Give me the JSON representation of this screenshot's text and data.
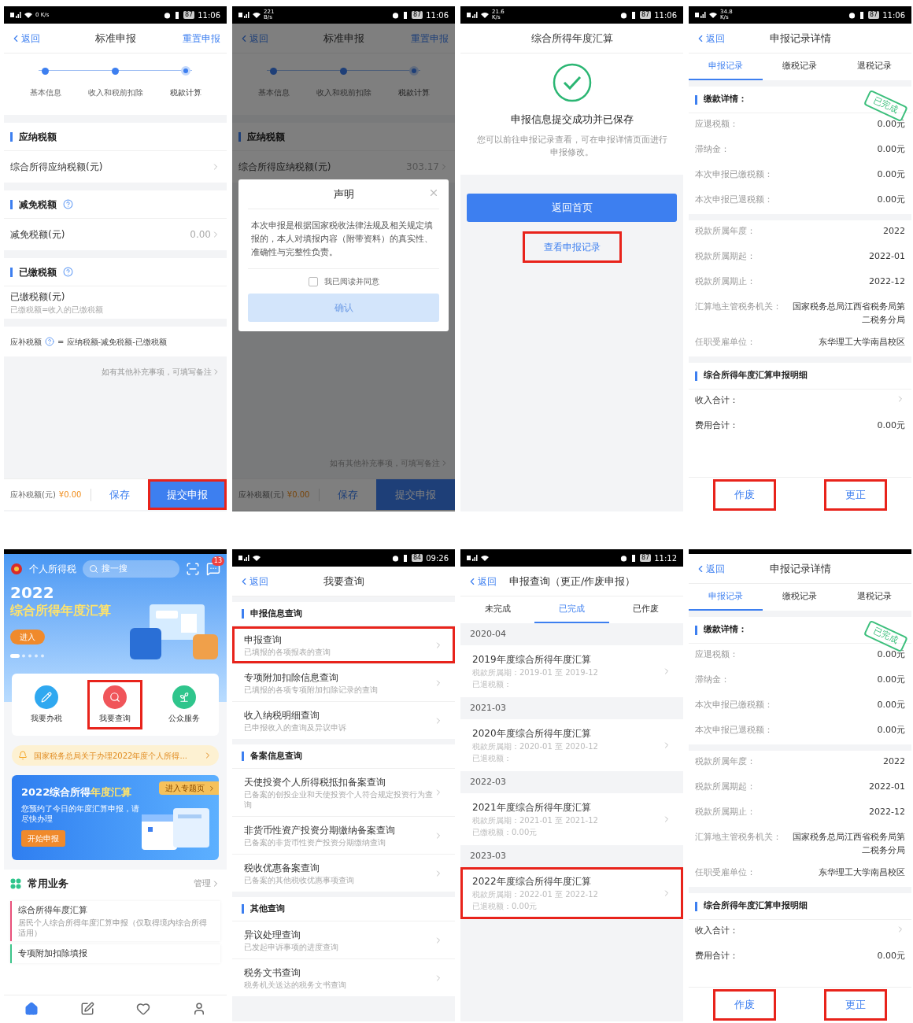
{
  "phones": [
    {
      "kind": "standard_report",
      "status": {
        "speed": "0 K/s",
        "battery": "87",
        "time": "11:06"
      },
      "nav": {
        "back": "返回",
        "title": "标准申报",
        "action": "重置申报"
      },
      "steps": [
        {
          "label": "基本信息",
          "selected": false
        },
        {
          "label": "收入和税前扣除",
          "selected": false
        },
        {
          "label": "税款计算",
          "selected": true
        }
      ],
      "sections": [
        {
          "title": "应纳税额",
          "help": false,
          "row": {
            "label": "综合所得应纳税额(元)",
            "arrow": true
          }
        },
        {
          "title": "减免税额",
          "help": true,
          "row": {
            "label": "减免税额(元)",
            "value": "0.00",
            "arrow": true
          }
        },
        {
          "title": "已缴税额",
          "help": true,
          "row": {
            "label": "已缴税额(元)",
            "note": "已缴税额=收入的已缴税额",
            "arrow": false
          }
        }
      ],
      "formula": {
        "label": "应补税额",
        "text": "= 应纳税额-减免税额-已缴税额"
      },
      "remark": "如有其他补充事项，可填写备注",
      "footer": {
        "label": "应补税额(元)",
        "amount": "¥0.00",
        "save": "保存",
        "submit": "提交申报",
        "highlighted": true
      }
    },
    {
      "kind": "standard_report",
      "status": {
        "speed": "221 B/s",
        "battery": "87",
        "time": "11:06"
      },
      "nav": {
        "back": "返回",
        "title": "标准申报",
        "action": "重置申报"
      },
      "steps": [
        {
          "label": "基本信息",
          "selected": false
        },
        {
          "label": "收入和税前扣除",
          "selected": false
        },
        {
          "label": "税款计算",
          "selected": true
        }
      ],
      "sections": [
        {
          "title": "应纳税额",
          "help": false,
          "row": {
            "label": "综合所得应纳税额(元)",
            "value": "303.17",
            "arrow": true
          }
        }
      ],
      "remark": "如有其他补充事项，可填写备注",
      "footer": {
        "label": "应补税额(元)",
        "amount": "¥0.00",
        "save": "保存",
        "submit": "提交申报",
        "highlighted": false
      },
      "dialog": {
        "title": "声明",
        "body": "本次申报是根据国家税收法律法规及相关规定填报的，本人对填报内容（附带资料）的真实性、准确性与完整性负责。",
        "agree": {
          "label": "我已阅读并同意",
          "checked": false
        },
        "confirm": {
          "label": "确认",
          "disabled": true
        }
      }
    },
    {
      "kind": "submit_success",
      "status": {
        "speed": "21.6 K/s",
        "battery": "87",
        "time": "11:06"
      },
      "nav": {
        "title": "综合所得年度汇算"
      },
      "heading": "申报信息提交成功并已保存",
      "message": "您可以前往申报记录查看，可在申报详情页面进行申报修改。",
      "primary": "返回首页",
      "link": {
        "label": "查看申报记录",
        "highlighted": true
      }
    },
    {
      "kind": "record_detail",
      "status": {
        "speed": "34.8 K/s",
        "battery": "87",
        "time": "11:06"
      },
      "nav": {
        "back": "返回",
        "title": "申报记录详情"
      },
      "tabs": [
        {
          "label": "申报记录",
          "selected": true
        },
        {
          "label": "缴税记录",
          "selected": false
        },
        {
          "label": "退税记录",
          "selected": false
        }
      ],
      "payment": {
        "title": "缴款详情：",
        "stamp": "已完成",
        "rows": [
          {
            "label": "应退税额：",
            "value": "0.00元"
          },
          {
            "label": "滞纳金：",
            "value": "0.00元"
          },
          {
            "label": "本次申报已缴税额：",
            "value": "0.00元"
          },
          {
            "label": "本次申报已退税额：",
            "value": "0.00元"
          }
        ]
      },
      "info_rows": [
        {
          "label": "税款所属年度：",
          "value": "2022"
        },
        {
          "label": "税款所属期起：",
          "value": "2022-01"
        },
        {
          "label": "税款所属期止：",
          "value": "2022-12"
        },
        {
          "label": "汇算地主管税务机关：",
          "value": "国家税务总局江西省税务局第二税务分局"
        },
        {
          "label": "任职受雇单位：",
          "value": "东华理工大学南昌校区"
        }
      ],
      "detail": {
        "title": "综合所得年度汇算申报明细",
        "rows": [
          {
            "label": "收入合计：",
            "arrow": true
          },
          {
            "label": "费用合计：",
            "value": "0.00元",
            "arrow": false
          }
        ]
      },
      "actions": [
        {
          "label": "作废",
          "highlighted": true
        },
        {
          "label": "更正",
          "highlighted": true
        }
      ]
    },
    {
      "kind": "home",
      "brand": "个人所得税",
      "search": {
        "placeholder": "搜一搜"
      },
      "badge": "13",
      "banner": {
        "year": "2022",
        "title": "综合所得年度汇算",
        "button": "进入"
      },
      "services": [
        {
          "kind": "pencil",
          "label": "我要办税",
          "color": "#2fa8f0",
          "highlighted": false
        },
        {
          "kind": "search",
          "label": "我要查询",
          "color": "#f0555a",
          "highlighted": true
        },
        {
          "kind": "sprout",
          "label": "公众服务",
          "color": "#2fc58c",
          "highlighted": false
        }
      ],
      "notice": "国家税务总局关于办理2022年度个人所得...",
      "promo": {
        "title": "2022综合所得",
        "accent": "年度汇算",
        "tag": "进入专题页",
        "text": "您预约了今日的年度汇算申报，请尽快办理",
        "button": "开始申报"
      },
      "common": {
        "title": "常用业务",
        "manage": "管理",
        "items": [
          {
            "title": "综合所得年度汇算",
            "desc": "居民个人综合所得年度汇算申报（仅取得境内综合所得适用）",
            "color": "#e8507a"
          },
          {
            "title": "专项附加扣除填报",
            "color": "#3cc48a"
          }
        ]
      },
      "tabbar": [
        {
          "kind": "home",
          "selected": true
        },
        {
          "kind": "list",
          "selected": false
        },
        {
          "kind": "heart",
          "selected": false
        },
        {
          "kind": "user",
          "selected": false
        }
      ]
    },
    {
      "kind": "query_menu",
      "status": {
        "battery": "84",
        "time": "09:26"
      },
      "nav": {
        "back": "返回",
        "title": "我要查询"
      },
      "groups": [
        {
          "title": "申报信息查询",
          "items": [
            {
              "title": "申报查询",
              "desc": "已填报的各项报表的查询",
              "highlighted": true
            },
            {
              "title": "专项附加扣除信息查询",
              "desc": "已填报的各项专项附加扣除记录的查询",
              "highlighted": false
            },
            {
              "title": "收入纳税明细查询",
              "desc": "已申报收入的查询及异议申诉",
              "highlighted": false
            }
          ]
        },
        {
          "title": "备案信息查询",
          "items": [
            {
              "title": "天使投资个人所得税抵扣备案查询",
              "desc": "已备案的创投企业和天使投资个人符合规定投资行为查询",
              "highlighted": false
            },
            {
              "title": "非货币性资产投资分期缴纳备案查询",
              "desc": "已备案的非货币性资产投资分期缴纳查询",
              "highlighted": false
            },
            {
              "title": "税收优惠备案查询",
              "desc": "已备案的其他税收优惠事项查询",
              "highlighted": false
            }
          ]
        },
        {
          "title": "其他查询",
          "items": [
            {
              "title": "异议处理查询",
              "desc": "已发起申诉事项的进度查询",
              "highlighted": false
            },
            {
              "title": "税务文书查询",
              "desc": "税务机关送达的税务文书查询",
              "highlighted": false
            }
          ]
        }
      ]
    },
    {
      "kind": "record_list",
      "status": {
        "battery": "87",
        "time": "11:12"
      },
      "nav": {
        "back": "返回",
        "title": "申报查询（更正/作废申报）"
      },
      "tabs": [
        {
          "label": "未完成",
          "selected": false
        },
        {
          "label": "已完成",
          "selected": true
        },
        {
          "label": "已作废",
          "selected": false
        }
      ],
      "records": [
        {
          "date": "2020-04",
          "title": "2019年度综合所得年度汇算",
          "period": "税款所属期：2019-01 至 2019-12",
          "amount": "已退税额：",
          "highlighted": false
        },
        {
          "date": "2021-03",
          "title": "2020年度综合所得年度汇算",
          "period": "税款所属期：2020-01 至 2020-12",
          "amount": "已退税额：",
          "highlighted": false
        },
        {
          "date": "2022-03",
          "title": "2021年度综合所得年度汇算",
          "period": "税款所属期：2021-01 至 2021-12",
          "amount": "已缴税额：0.00元",
          "highlighted": false
        },
        {
          "date": "2023-03",
          "title": "2022年度综合所得年度汇算",
          "period": "税款所属期：2022-01 至 2022-12",
          "amount": "已退税额：0.00元",
          "highlighted": true
        }
      ]
    },
    {
      "kind": "record_detail",
      "nav": {
        "back": "返回",
        "title": "申报记录详情"
      },
      "tabs": [
        {
          "label": "申报记录",
          "selected": true
        },
        {
          "label": "缴税记录",
          "selected": false
        },
        {
          "label": "退税记录",
          "selected": false
        }
      ],
      "payment": {
        "title": "缴款详情：",
        "stamp": "已完成",
        "rows": [
          {
            "label": "应退税额：",
            "value": "0.00元"
          },
          {
            "label": "滞纳金：",
            "value": "0.00元"
          },
          {
            "label": "本次申报已缴税额：",
            "value": "0.00元"
          },
          {
            "label": "本次申报已退税额：",
            "value": "0.00元"
          }
        ]
      },
      "info_rows": [
        {
          "label": "税款所属年度：",
          "value": "2022"
        },
        {
          "label": "税款所属期起：",
          "value": "2022-01"
        },
        {
          "label": "税款所属期止：",
          "value": "2022-12"
        },
        {
          "label": "汇算地主管税务机关：",
          "value": "国家税务总局江西省税务局第二税务分局"
        },
        {
          "label": "任职受雇单位：",
          "value": "东华理工大学南昌校区"
        }
      ],
      "detail": {
        "title": "综合所得年度汇算申报明细",
        "rows": [
          {
            "label": "收入合计：",
            "arrow": true
          },
          {
            "label": "费用合计：",
            "value": "0.00元",
            "arrow": false
          }
        ]
      },
      "actions": [
        {
          "label": "作废",
          "highlighted": true
        },
        {
          "label": "更正",
          "highlighted": true
        }
      ]
    }
  ]
}
